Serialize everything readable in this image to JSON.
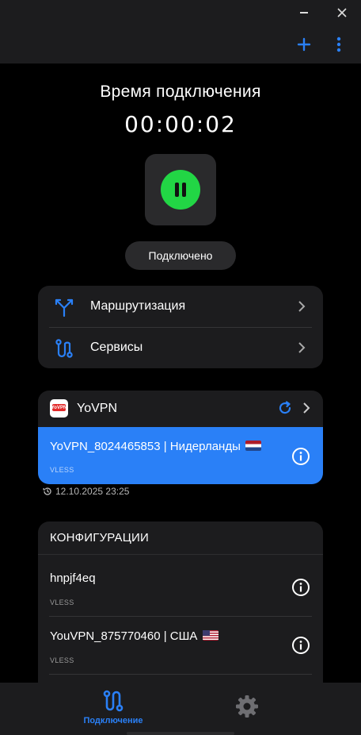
{
  "titlebar": {
    "minimize_icon": "minimize-icon",
    "close_icon": "close-icon",
    "add_icon": "plus-icon",
    "more_icon": "more-vertical-icon"
  },
  "connection": {
    "title": "Время подключения",
    "timer": "00:00:02",
    "status": "Подключено",
    "button_color": "#22d645"
  },
  "menu": {
    "items": [
      {
        "label": "Маршрутизация",
        "icon": "routing-icon"
      },
      {
        "label": "Сервисы",
        "icon": "services-icon"
      }
    ]
  },
  "subscription": {
    "logo_text": "YoVPN",
    "name": "YoVPN",
    "active_server": {
      "name": "YoVPN_8024465853 | Нидерланды",
      "flag": "NL",
      "protocol": "VLESS"
    },
    "updated": "12.10.2025 23:25"
  },
  "configs": {
    "title": "КОНФИГУРАЦИИ",
    "items": [
      {
        "name": "hnpjf4eq",
        "protocol": "VLESS"
      },
      {
        "name": "YouVPN_875770460 | США",
        "flag": "US",
        "protocol": "VLESS"
      }
    ]
  },
  "nav": {
    "connect_label": "Подключение",
    "accent": "#2a80f7"
  }
}
